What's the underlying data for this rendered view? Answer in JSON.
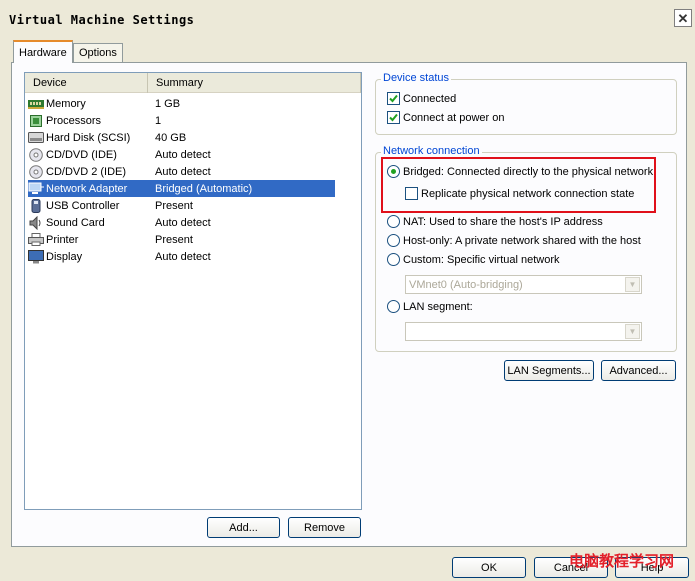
{
  "window": {
    "title": "Virtual Machine Settings",
    "close_glyph": "✕"
  },
  "tabs": [
    {
      "label": "Hardware",
      "active": true
    },
    {
      "label": "Options",
      "active": false
    }
  ],
  "device_list": {
    "columns": [
      "Device",
      "Summary"
    ],
    "rows": [
      {
        "icon": "memory-icon",
        "device": "Memory",
        "summary": "1 GB"
      },
      {
        "icon": "processor-icon",
        "device": "Processors",
        "summary": "1"
      },
      {
        "icon": "hard-disk-icon",
        "device": "Hard Disk (SCSI)",
        "summary": "40 GB"
      },
      {
        "icon": "cd-dvd-icon",
        "device": "CD/DVD (IDE)",
        "summary": "Auto detect"
      },
      {
        "icon": "cd-dvd-icon",
        "device": "CD/DVD 2 (IDE)",
        "summary": "Auto detect"
      },
      {
        "icon": "network-adapter-icon",
        "device": "Network Adapter",
        "summary": "Bridged (Automatic)",
        "selected": true
      },
      {
        "icon": "usb-icon",
        "device": "USB Controller",
        "summary": "Present"
      },
      {
        "icon": "sound-card-icon",
        "device": "Sound Card",
        "summary": "Auto detect"
      },
      {
        "icon": "printer-icon",
        "device": "Printer",
        "summary": "Present"
      },
      {
        "icon": "display-icon",
        "device": "Display",
        "summary": "Auto detect"
      }
    ]
  },
  "list_buttons": {
    "add": "Add...",
    "remove": "Remove"
  },
  "device_status": {
    "legend": "Device status",
    "connected": {
      "label": "Connected",
      "checked": true
    },
    "connect_at_power_on": {
      "label": "Connect at power on",
      "checked": true
    }
  },
  "network_connection": {
    "legend": "Network connection",
    "bridged": {
      "label": "Bridged: Connected directly to the physical network",
      "selected": true
    },
    "replicate": {
      "label": "Replicate physical network connection state",
      "checked": false
    },
    "nat": {
      "label": "NAT: Used to share the host's IP address",
      "selected": false
    },
    "host_only": {
      "label": "Host-only: A private network shared with the host",
      "selected": false
    },
    "custom": {
      "label": "Custom: Specific virtual network",
      "selected": false
    },
    "custom_select_value": "VMnet0 (Auto-bridging)",
    "lan_segment": {
      "label": "LAN segment:",
      "selected": false
    },
    "lan_segment_select_value": ""
  },
  "network_buttons": {
    "lan_segments": "LAN Segments...",
    "advanced": "Advanced..."
  },
  "dialog_buttons": {
    "ok": "OK",
    "cancel": "Cancel",
    "help": "Help"
  },
  "watermark": "电脑教程学习网",
  "colors": {
    "selection": "#316ac5",
    "legend": "#0046d5",
    "highlight_box": "#e0101a",
    "watermark": "#e3202a"
  }
}
